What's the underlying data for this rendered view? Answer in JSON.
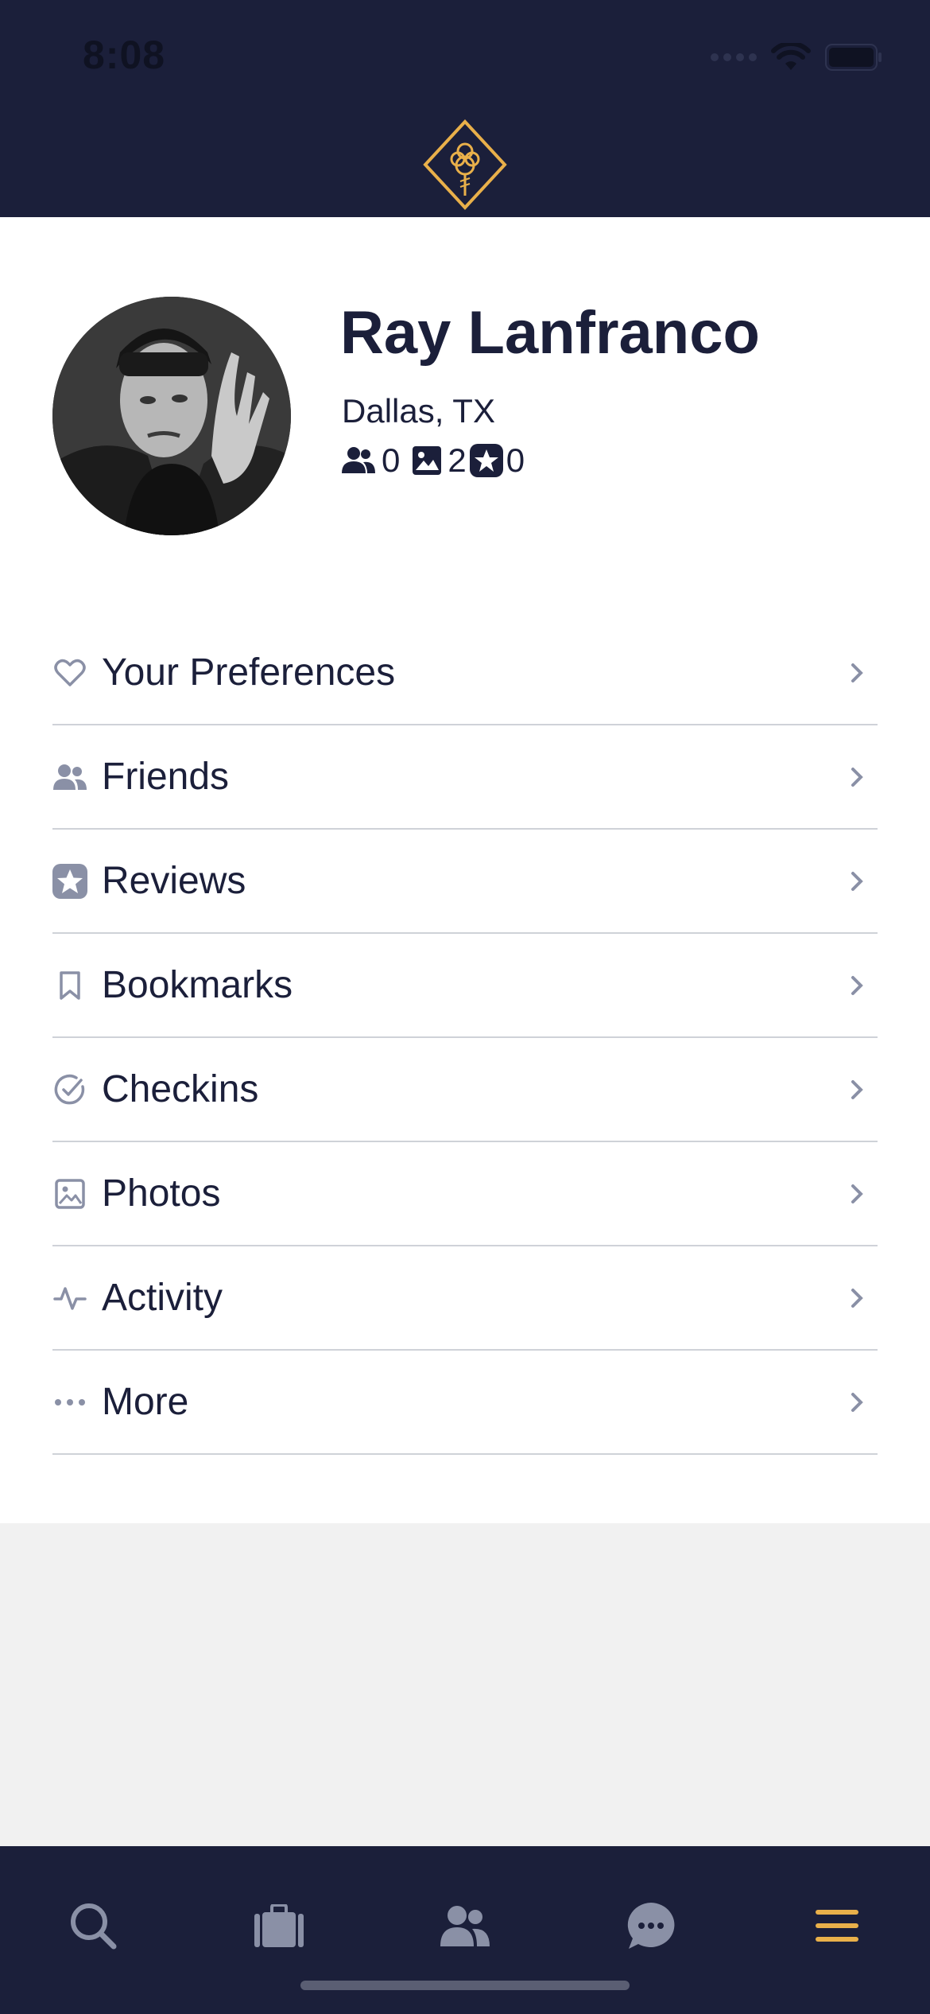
{
  "status_bar": {
    "time": "8:08"
  },
  "profile": {
    "name": "Ray Lanfranco",
    "location": "Dallas, TX",
    "stats": {
      "friends": "0",
      "photos": "2",
      "reviews": "0"
    }
  },
  "menu": {
    "items": [
      {
        "label": "Your Preferences",
        "icon": "heart-icon"
      },
      {
        "label": "Friends",
        "icon": "friends-icon"
      },
      {
        "label": "Reviews",
        "icon": "star-badge-icon"
      },
      {
        "label": "Bookmarks",
        "icon": "bookmark-icon"
      },
      {
        "label": "Checkins",
        "icon": "check-circle-icon"
      },
      {
        "label": "Photos",
        "icon": "photo-icon"
      },
      {
        "label": "Activity",
        "icon": "activity-icon"
      },
      {
        "label": "More",
        "icon": "more-dots-icon"
      }
    ]
  },
  "tab_bar": {
    "tabs": [
      {
        "name": "search",
        "icon": "search-icon",
        "active": false
      },
      {
        "name": "suitcase",
        "icon": "suitcase-icon",
        "active": false
      },
      {
        "name": "friends",
        "icon": "people-icon",
        "active": false
      },
      {
        "name": "messages",
        "icon": "chat-icon",
        "active": false
      },
      {
        "name": "menu",
        "icon": "hamburger-menu-icon",
        "active": true
      }
    ]
  },
  "colors": {
    "header_bg": "#1b1f3a",
    "accent_gold": "#e9b04a",
    "text_dark": "#1b1f3a",
    "icon_muted": "#8a90a6"
  }
}
